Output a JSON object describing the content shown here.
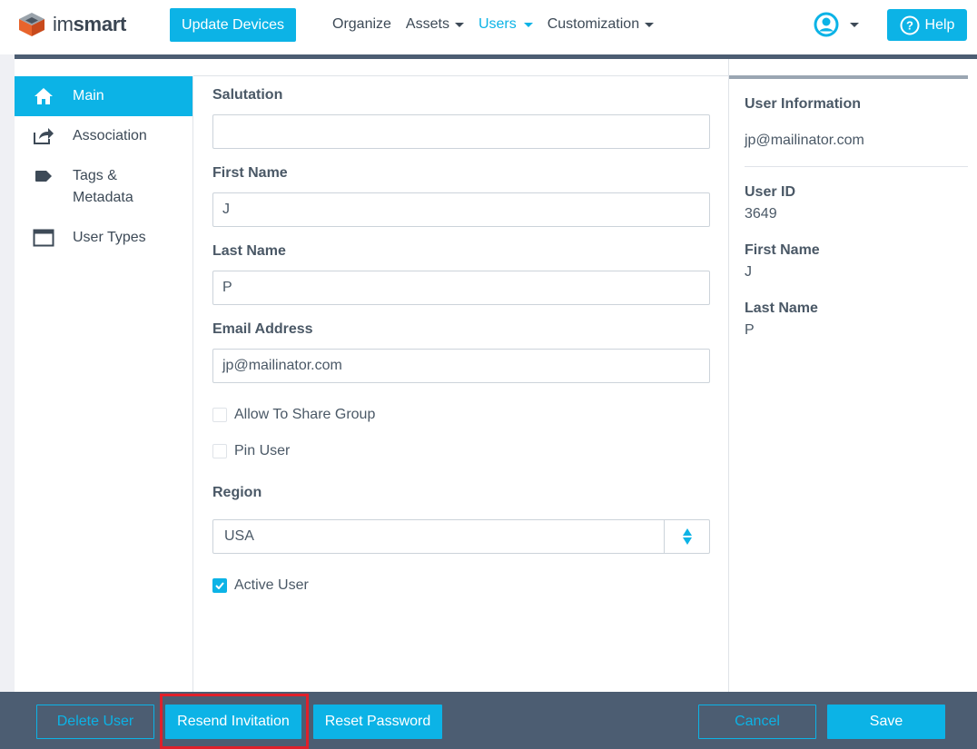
{
  "header": {
    "logo_prefix": "im",
    "logo_suffix": "smart",
    "update_button": "Update Devices",
    "nav": [
      {
        "label": "Organize",
        "dropdown": false,
        "active": false
      },
      {
        "label": "Assets",
        "dropdown": true,
        "active": false
      },
      {
        "label": "Users",
        "dropdown": true,
        "active": true
      },
      {
        "label": "Customization",
        "dropdown": true,
        "active": false
      }
    ],
    "help_button": "Help",
    "accent_color": "#0cb3e6"
  },
  "sidebar": {
    "items": [
      {
        "label": "Main",
        "icon": "home-icon",
        "active": true
      },
      {
        "label": "Association",
        "icon": "share-icon",
        "active": false
      },
      {
        "label": "Tags &",
        "label2": "Metadata",
        "icon": "tag-icon",
        "active": false
      },
      {
        "label": "User Types",
        "icon": "window-icon",
        "active": false
      }
    ]
  },
  "form": {
    "salutation": {
      "label": "Salutation",
      "value": ""
    },
    "first_name": {
      "label": "First Name",
      "value": "J"
    },
    "last_name": {
      "label": "Last Name",
      "value": "P"
    },
    "email": {
      "label": "Email Address",
      "value": "jp@mailinator.com"
    },
    "allow_share_group": {
      "label": "Allow To Share Group",
      "checked": false
    },
    "pin_user": {
      "label": "Pin User",
      "checked": false
    },
    "region": {
      "label": "Region",
      "value": "USA"
    },
    "active_user": {
      "label": "Active User",
      "checked": true
    }
  },
  "info": {
    "title": "User Information",
    "email": "jp@mailinator.com",
    "user_id_label": "User ID",
    "user_id": "3649",
    "first_name_label": "First Name",
    "first_name": "J",
    "last_name_label": "Last Name",
    "last_name": "P"
  },
  "footer": {
    "delete_user": "Delete User",
    "resend_invitation": "Resend Invitation",
    "reset_password": "Reset Password",
    "cancel": "Cancel",
    "save": "Save",
    "highlight_color": "#e0202a"
  }
}
